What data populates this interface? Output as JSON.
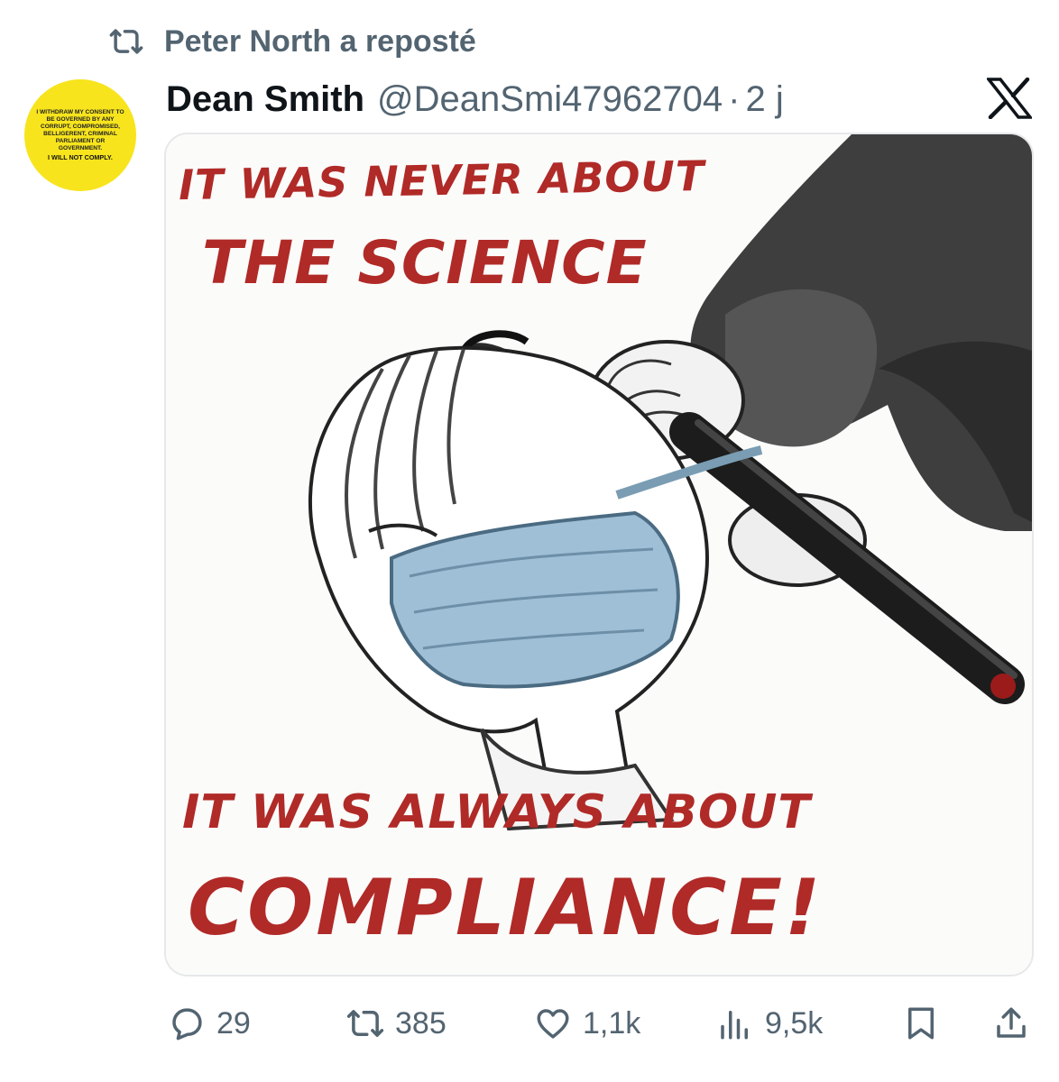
{
  "repost": {
    "text": "Peter North a reposté",
    "icon": "repost-icon"
  },
  "author": {
    "name": "Dean Smith",
    "handle": "@DeanSmi47962704",
    "separator": "·",
    "time": "2 j"
  },
  "avatar": {
    "badge_text": "I WITHDRAW MY CONSENT TO BE GOVERNED BY ANY CORRUPT, COMPROMISED, BELLIGERENT, CRIMINAL PARLIAMENT OR GOVERNMENT.",
    "badge_footer": "I WILL NOT COMPLY.",
    "color": "#f7e41d"
  },
  "platform_logo": "x-logo-icon",
  "media": {
    "line1": "IT WAS NEVER ABOUT",
    "line2": "THE SCIENCE",
    "line3": "IT WAS ALWAYS ABOUT",
    "line4": "COMPLIANCE!",
    "text_color": "#b02a27"
  },
  "actions": {
    "replies": "29",
    "reposts": "385",
    "likes": "1,1k",
    "views": "9,5k",
    "bookmark_icon": "bookmark-icon",
    "share_icon": "share-icon"
  },
  "colors": {
    "secondary_text": "#536471",
    "primary_text": "#0f1419"
  }
}
